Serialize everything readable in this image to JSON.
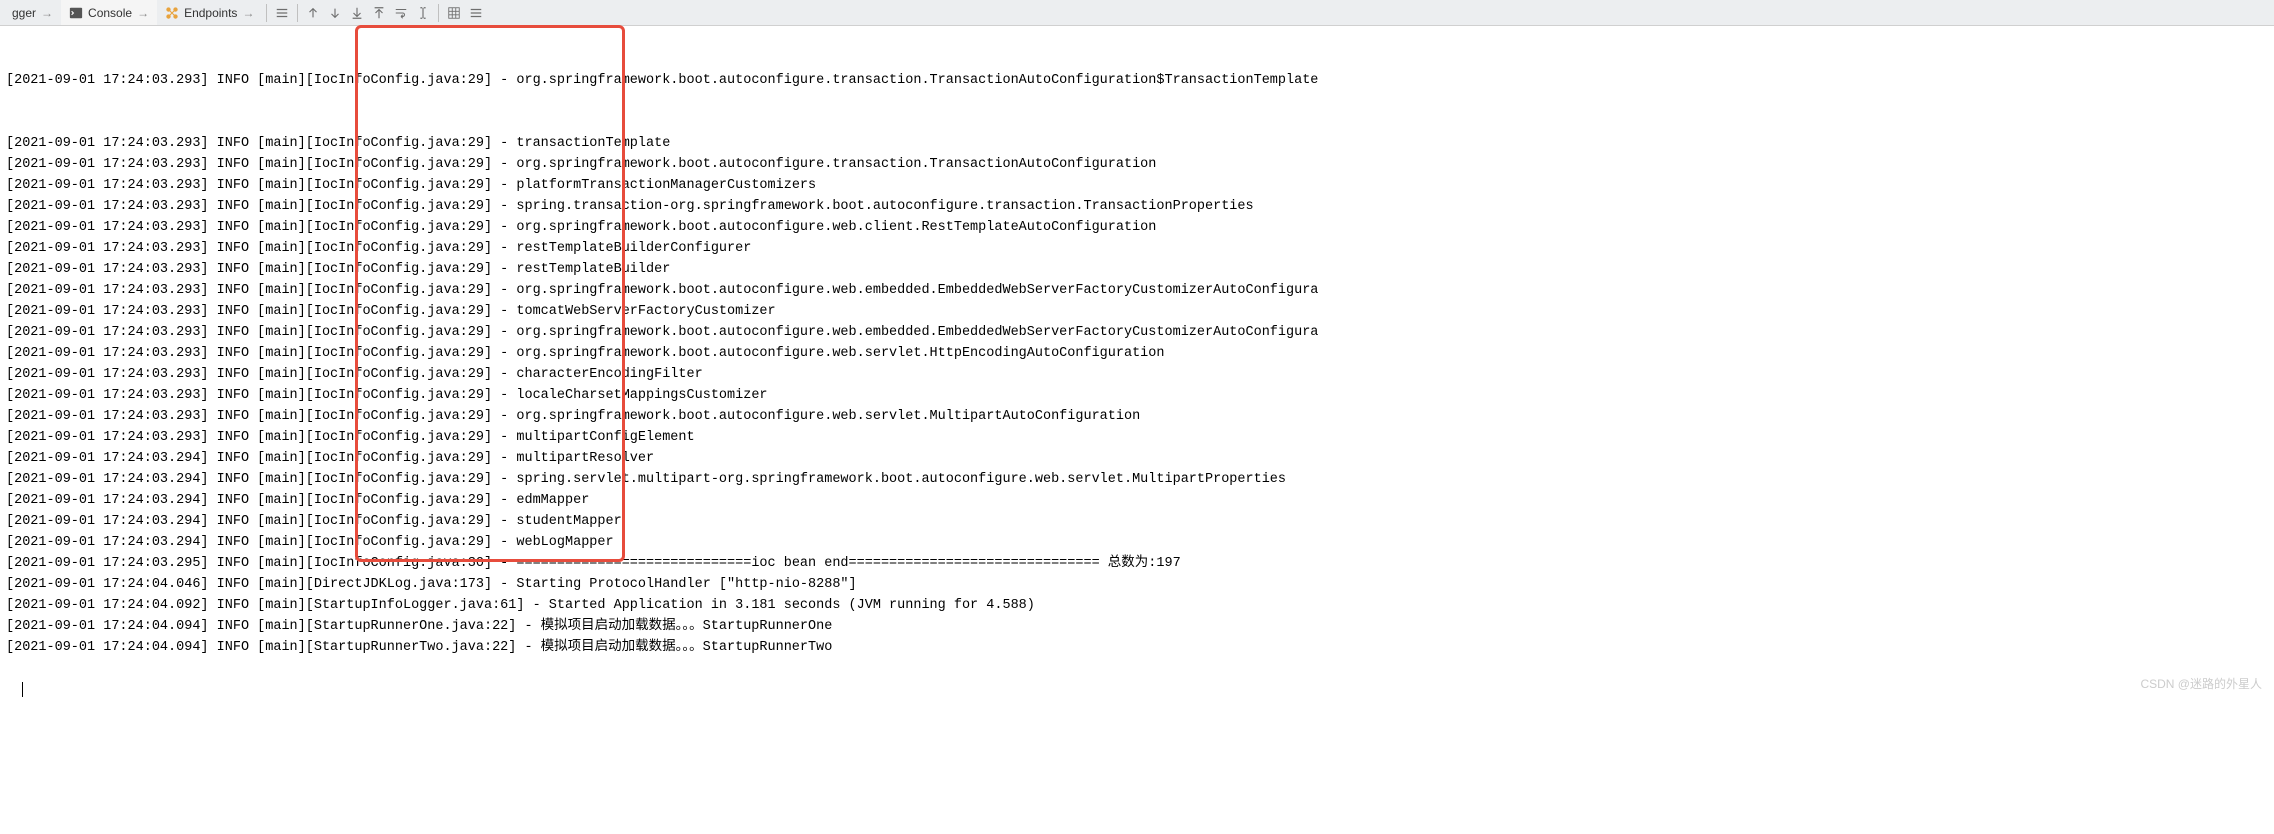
{
  "toolbar": {
    "tabs": [
      {
        "label": "gger",
        "icon": "debugger"
      },
      {
        "label": "Console",
        "icon": "console"
      },
      {
        "label": "Endpoints",
        "icon": "endpoints"
      }
    ]
  },
  "log_prefix_truncated": "[2021-09-01 17:24:03.293] INFO [main][IocInfoConfig.java:29] - org.springframework.boot.autoconfigure.transaction.TransactionAutoConfiguration$TransactionTemplate",
  "log_lines": [
    {
      "ts": "2021-09-01 17:24:03.293",
      "lv": "INFO",
      "th": "main",
      "src": "IocInfoConfig.java:29",
      "msg": "transactionTemplate"
    },
    {
      "ts": "2021-09-01 17:24:03.293",
      "lv": "INFO",
      "th": "main",
      "src": "IocInfoConfig.java:29",
      "msg": "org.springframework.boot.autoconfigure.transaction.TransactionAutoConfiguration"
    },
    {
      "ts": "2021-09-01 17:24:03.293",
      "lv": "INFO",
      "th": "main",
      "src": "IocInfoConfig.java:29",
      "msg": "platformTransactionManagerCustomizers"
    },
    {
      "ts": "2021-09-01 17:24:03.293",
      "lv": "INFO",
      "th": "main",
      "src": "IocInfoConfig.java:29",
      "msg": "spring.transaction-org.springframework.boot.autoconfigure.transaction.TransactionProperties"
    },
    {
      "ts": "2021-09-01 17:24:03.293",
      "lv": "INFO",
      "th": "main",
      "src": "IocInfoConfig.java:29",
      "msg": "org.springframework.boot.autoconfigure.web.client.RestTemplateAutoConfiguration"
    },
    {
      "ts": "2021-09-01 17:24:03.293",
      "lv": "INFO",
      "th": "main",
      "src": "IocInfoConfig.java:29",
      "msg": "restTemplateBuilderConfigurer"
    },
    {
      "ts": "2021-09-01 17:24:03.293",
      "lv": "INFO",
      "th": "main",
      "src": "IocInfoConfig.java:29",
      "msg": "restTemplateBuilder"
    },
    {
      "ts": "2021-09-01 17:24:03.293",
      "lv": "INFO",
      "th": "main",
      "src": "IocInfoConfig.java:29",
      "msg": "org.springframework.boot.autoconfigure.web.embedded.EmbeddedWebServerFactoryCustomizerAutoConfigura"
    },
    {
      "ts": "2021-09-01 17:24:03.293",
      "lv": "INFO",
      "th": "main",
      "src": "IocInfoConfig.java:29",
      "msg": "tomcatWebServerFactoryCustomizer"
    },
    {
      "ts": "2021-09-01 17:24:03.293",
      "lv": "INFO",
      "th": "main",
      "src": "IocInfoConfig.java:29",
      "msg": "org.springframework.boot.autoconfigure.web.embedded.EmbeddedWebServerFactoryCustomizerAutoConfigura"
    },
    {
      "ts": "2021-09-01 17:24:03.293",
      "lv": "INFO",
      "th": "main",
      "src": "IocInfoConfig.java:29",
      "msg": "org.springframework.boot.autoconfigure.web.servlet.HttpEncodingAutoConfiguration"
    },
    {
      "ts": "2021-09-01 17:24:03.293",
      "lv": "INFO",
      "th": "main",
      "src": "IocInfoConfig.java:29",
      "msg": "characterEncodingFilter"
    },
    {
      "ts": "2021-09-01 17:24:03.293",
      "lv": "INFO",
      "th": "main",
      "src": "IocInfoConfig.java:29",
      "msg": "localeCharsetMappingsCustomizer"
    },
    {
      "ts": "2021-09-01 17:24:03.293",
      "lv": "INFO",
      "th": "main",
      "src": "IocInfoConfig.java:29",
      "msg": "org.springframework.boot.autoconfigure.web.servlet.MultipartAutoConfiguration"
    },
    {
      "ts": "2021-09-01 17:24:03.293",
      "lv": "INFO",
      "th": "main",
      "src": "IocInfoConfig.java:29",
      "msg": "multipartConfigElement"
    },
    {
      "ts": "2021-09-01 17:24:03.294",
      "lv": "INFO",
      "th": "main",
      "src": "IocInfoConfig.java:29",
      "msg": "multipartResolver"
    },
    {
      "ts": "2021-09-01 17:24:03.294",
      "lv": "INFO",
      "th": "main",
      "src": "IocInfoConfig.java:29",
      "msg": "spring.servlet.multipart-org.springframework.boot.autoconfigure.web.servlet.MultipartProperties"
    },
    {
      "ts": "2021-09-01 17:24:03.294",
      "lv": "INFO",
      "th": "main",
      "src": "IocInfoConfig.java:29",
      "msg": "edmMapper"
    },
    {
      "ts": "2021-09-01 17:24:03.294",
      "lv": "INFO",
      "th": "main",
      "src": "IocInfoConfig.java:29",
      "msg": "studentMapper"
    },
    {
      "ts": "2021-09-01 17:24:03.294",
      "lv": "INFO",
      "th": "main",
      "src": "IocInfoConfig.java:29",
      "msg": "webLogMapper"
    },
    {
      "ts": "2021-09-01 17:24:03.295",
      "lv": "INFO",
      "th": "main",
      "src": "IocInfoConfig.java:30",
      "msg": "=============================ioc bean end=============================== 总数为:197"
    },
    {
      "ts": "2021-09-01 17:24:04.046",
      "lv": "INFO",
      "th": "main",
      "src": "DirectJDKLog.java:173",
      "msg": "Starting ProtocolHandler [\"http-nio-8288\"]"
    },
    {
      "ts": "2021-09-01 17:24:04.092",
      "lv": "INFO",
      "th": "main",
      "src": "StartupInfoLogger.java:61",
      "msg": "Started Application in 3.181 seconds (JVM running for 4.588)"
    },
    {
      "ts": "2021-09-01 17:24:04.094",
      "lv": "INFO",
      "th": "main",
      "src": "StartupRunnerOne.java:22",
      "msg": "模拟项目启动加载数据。。。StartupRunnerOne"
    },
    {
      "ts": "2021-09-01 17:24:04.094",
      "lv": "INFO",
      "th": "main",
      "src": "StartupRunnerTwo.java:22",
      "msg": "模拟项目启动加载数据。。。StartupRunnerTwo"
    }
  ],
  "watermark": "CSDN @迷路的外星人"
}
